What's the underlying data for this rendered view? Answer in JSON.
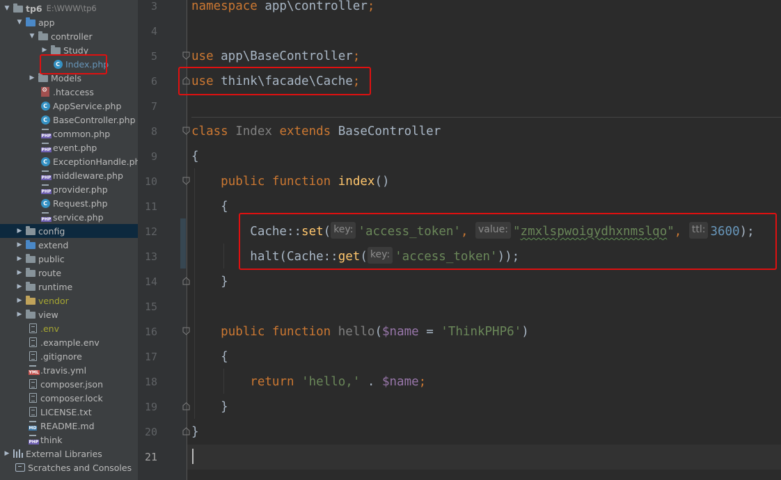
{
  "project_tree": {
    "root": {
      "name": "tp6",
      "path": "E:\\WWW\\tp6"
    },
    "items": [
      {
        "label": "app"
      },
      {
        "label": "controller"
      },
      {
        "label": "Study"
      },
      {
        "label": "Index.php"
      },
      {
        "label": "Models"
      },
      {
        "label": ".htaccess"
      },
      {
        "label": "AppService.php"
      },
      {
        "label": "BaseController.php"
      },
      {
        "label": "common.php"
      },
      {
        "label": "event.php"
      },
      {
        "label": "ExceptionHandle.php"
      },
      {
        "label": "middleware.php"
      },
      {
        "label": "provider.php"
      },
      {
        "label": "Request.php"
      },
      {
        "label": "service.php"
      },
      {
        "label": "config"
      },
      {
        "label": "extend"
      },
      {
        "label": "public"
      },
      {
        "label": "route"
      },
      {
        "label": "runtime"
      },
      {
        "label": "vendor"
      },
      {
        "label": "view"
      },
      {
        "label": ".env"
      },
      {
        "label": ".example.env"
      },
      {
        "label": ".gitignore"
      },
      {
        "label": ".travis.yml"
      },
      {
        "label": "composer.json"
      },
      {
        "label": "composer.lock"
      },
      {
        "label": "LICENSE.txt"
      },
      {
        "label": "README.md"
      },
      {
        "label": "think"
      },
      {
        "label": "External Libraries"
      },
      {
        "label": "Scratches and Consoles"
      }
    ]
  },
  "editor": {
    "line_numbers": [
      "3",
      "4",
      "5",
      "6",
      "7",
      "8",
      "9",
      "10",
      "11",
      "12",
      "13",
      "14",
      "15",
      "16",
      "17",
      "18",
      "19",
      "20",
      "21"
    ],
    "current_line": "21",
    "code": {
      "l3": [
        "namespace",
        " app\\controller",
        ";"
      ],
      "l5": [
        "use",
        " app\\BaseController",
        ";"
      ],
      "l6": [
        "use",
        " think\\facade\\Cache",
        ";"
      ],
      "l8": [
        "class",
        " Index ",
        "extends",
        " BaseController"
      ],
      "l9": [
        "{"
      ],
      "l10": [
        "    ",
        "public",
        " ",
        "function",
        " ",
        "index",
        "()"
      ],
      "l11": [
        "    {"
      ],
      "l12": {
        "prefix": "        Cache::",
        "method": "set",
        "open": "(",
        "hint1": "key:",
        "arg1": "'access_token'",
        "comma1": ", ",
        "hint2": "value:",
        "arg2_q1": "\"",
        "arg2": "zmxlspwoigydhxnmslqo",
        "arg2_q2": "\"",
        "comma2": ", ",
        "hint3": "ttl:",
        "arg3": "3600",
        "close": ");"
      },
      "l13": {
        "prefix": "        halt(Cache::",
        "method": "get",
        "open": "(",
        "hint1": "key:",
        "arg1": "'access_token'",
        "close": "));"
      },
      "l14": [
        "    }"
      ],
      "l16": {
        "indent": "    ",
        "kw1": "public",
        "kw2": "function",
        "name": "hello",
        "open": "(",
        "param": "$name",
        "eq": " = ",
        "default": "'ThinkPHP6'",
        "close": ")"
      },
      "l17": [
        "    {"
      ],
      "l18": {
        "indent": "        ",
        "kw": "return",
        "str": "'hello,'",
        "dot": " . ",
        "var": "$name",
        "semi": ";"
      },
      "l19": [
        "    }"
      ],
      "l20": [
        "}"
      ]
    }
  },
  "colors": {
    "highlight_box": "#e01010",
    "keyword": "#cc7832",
    "string": "#6a8759",
    "number": "#6897bb",
    "method": "#ffc66d",
    "variable": "#9876aa"
  }
}
